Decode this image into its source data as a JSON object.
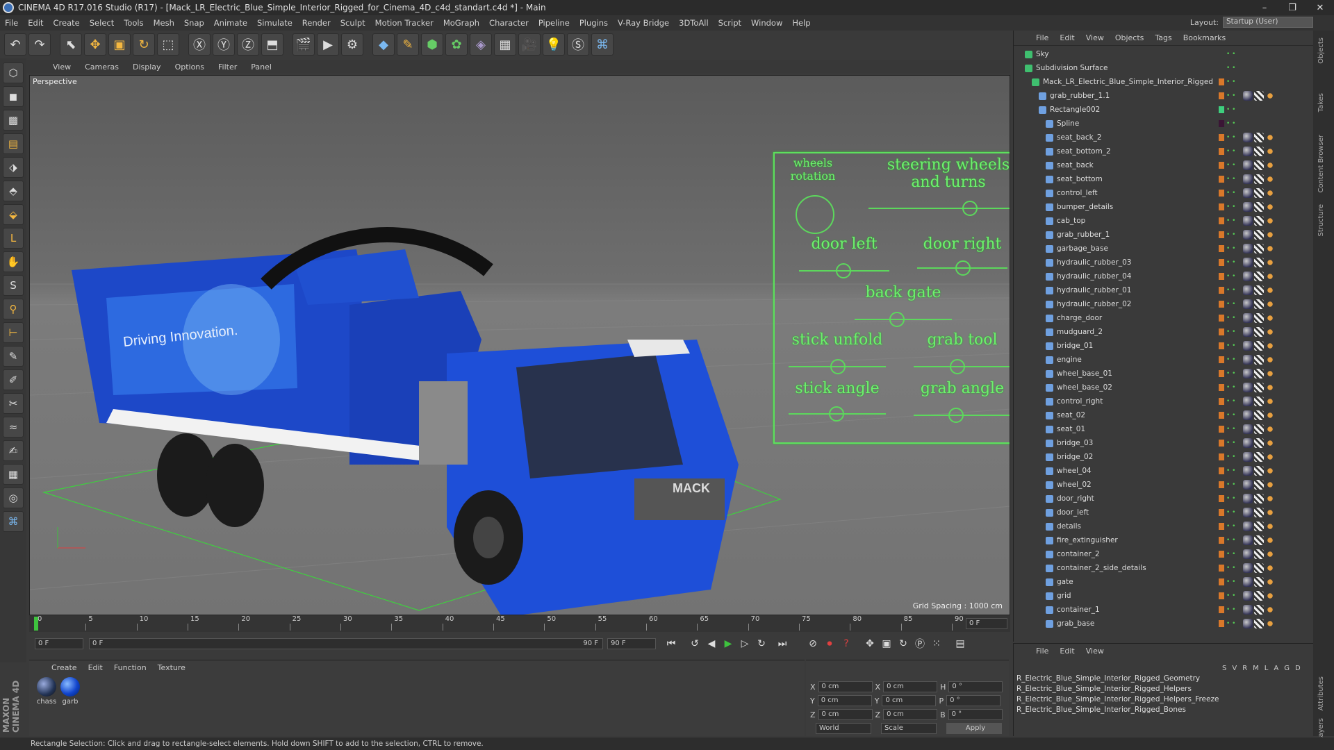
{
  "window": {
    "title": "CINEMA 4D R17.016 Studio (R17) - [Mack_LR_Electric_Blue_Simple_Interior_Rigged_for_Cinema_4D_c4d_standart.c4d *] - Main"
  },
  "menu": [
    "File",
    "Edit",
    "Create",
    "Select",
    "Tools",
    "Mesh",
    "Snap",
    "Animate",
    "Simulate",
    "Render",
    "Sculpt",
    "Motion Tracker",
    "MoGraph",
    "Character",
    "Pipeline",
    "Plugins",
    "V-Ray Bridge",
    "3DToAll",
    "Script",
    "Window",
    "Help"
  ],
  "layout": {
    "label": "Layout:",
    "value": "Startup (User)"
  },
  "viewport": {
    "menu": [
      "View",
      "Cameras",
      "Display",
      "Options",
      "Filter",
      "Panel"
    ],
    "label": "Perspective",
    "grid_spacing": "Grid Spacing : 1000 cm",
    "truck_text": "Driving Innovation.",
    "hud": {
      "wheels_rotation": "wheels rotation",
      "steering": "steering wheels and turns",
      "door_left": "door left",
      "door_right": "door right",
      "back_gate": "back gate",
      "stick_unfold": "stick unfold",
      "grab_tool": "grab tool",
      "stick_angle": "stick angle",
      "grab_angle": "grab angle"
    }
  },
  "timeline": {
    "ticks": [
      "0",
      "5",
      "10",
      "15",
      "20",
      "25",
      "30",
      "35",
      "40",
      "45",
      "50",
      "55",
      "60",
      "65",
      "70",
      "75",
      "80",
      "85",
      "90"
    ],
    "end_frame": "0 F"
  },
  "playback": {
    "start": "0 F",
    "current": "0 F",
    "range_end": "90 F",
    "max": "90 F"
  },
  "materials": {
    "menu": [
      "Create",
      "Edit",
      "Function",
      "Texture"
    ],
    "items": [
      "chass",
      "garb"
    ]
  },
  "coords": {
    "rows": [
      {
        "axis": "X",
        "pos": "0 cm",
        "axis2": "X",
        "size": "0 cm",
        "axis3": "H",
        "rot": "0 °"
      },
      {
        "axis": "Y",
        "pos": "0 cm",
        "axis2": "Y",
        "size": "0 cm",
        "axis3": "P",
        "rot": "0 °"
      },
      {
        "axis": "Z",
        "pos": "0 cm",
        "axis2": "Z",
        "size": "0 cm",
        "axis3": "B",
        "rot": "0 °"
      }
    ],
    "world": "World",
    "scale": "Scale",
    "apply": "Apply"
  },
  "objects": {
    "menu": [
      "File",
      "Edit",
      "View",
      "Objects",
      "Tags",
      "Bookmarks"
    ],
    "items": [
      {
        "name": "Sky",
        "level": 0
      },
      {
        "name": "Subdivision Surface",
        "level": 0
      },
      {
        "name": "Mack_LR_Electric_Blue_Simple_Interior_Rigged",
        "level": 1
      },
      {
        "name": "grab_rubber_1.1",
        "level": 2
      },
      {
        "name": "Rectangle002",
        "level": 2
      },
      {
        "name": "Spline",
        "level": 3
      },
      {
        "name": "seat_back_2",
        "level": 3
      },
      {
        "name": "seat_bottom_2",
        "level": 3
      },
      {
        "name": "seat_back",
        "level": 3
      },
      {
        "name": "seat_bottom",
        "level": 3
      },
      {
        "name": "control_left",
        "level": 3
      },
      {
        "name": "bumper_details",
        "level": 3
      },
      {
        "name": "cab_top",
        "level": 3
      },
      {
        "name": "grab_rubber_1",
        "level": 3
      },
      {
        "name": "garbage_base",
        "level": 3
      },
      {
        "name": "hydraulic_rubber_03",
        "level": 3
      },
      {
        "name": "hydraulic_rubber_04",
        "level": 3
      },
      {
        "name": "hydraulic_rubber_01",
        "level": 3
      },
      {
        "name": "hydraulic_rubber_02",
        "level": 3
      },
      {
        "name": "charge_door",
        "level": 3
      },
      {
        "name": "mudguard_2",
        "level": 3
      },
      {
        "name": "bridge_01",
        "level": 3
      },
      {
        "name": "engine",
        "level": 3
      },
      {
        "name": "wheel_base_01",
        "level": 3
      },
      {
        "name": "wheel_base_02",
        "level": 3
      },
      {
        "name": "control_right",
        "level": 3
      },
      {
        "name": "seat_02",
        "level": 3
      },
      {
        "name": "seat_01",
        "level": 3
      },
      {
        "name": "bridge_03",
        "level": 3
      },
      {
        "name": "bridge_02",
        "level": 3
      },
      {
        "name": "wheel_04",
        "level": 3
      },
      {
        "name": "wheel_02",
        "level": 3
      },
      {
        "name": "door_right",
        "level": 3
      },
      {
        "name": "door_left",
        "level": 3
      },
      {
        "name": "details",
        "level": 3
      },
      {
        "name": "fire_extinguisher",
        "level": 3
      },
      {
        "name": "container_2",
        "level": 3
      },
      {
        "name": "container_2_side_details",
        "level": 3
      },
      {
        "name": "gate",
        "level": 3
      },
      {
        "name": "grid",
        "level": 3
      },
      {
        "name": "container_1",
        "level": 3
      },
      {
        "name": "grab_base",
        "level": 3
      }
    ]
  },
  "layers": {
    "menu": [
      "File",
      "Edit",
      "View"
    ],
    "columns": [
      "S",
      "V",
      "R",
      "M",
      "L",
      "A",
      "G",
      "D"
    ],
    "items": [
      "R_Electric_Blue_Simple_Interior_Rigged_Geometry",
      "R_Electric_Blue_Simple_Interior_Rigged_Helpers",
      "R_Electric_Blue_Simple_Interior_Rigged_Helpers_Freeze",
      "R_Electric_Blue_Simple_Interior_Rigged_Bones"
    ]
  },
  "status": "Rectangle Selection: Click and drag to rectangle-select elements. Hold down SHIFT to add to the selection, CTRL to remove.",
  "side_tabs": [
    "Objects",
    "Takes",
    "Content Browser",
    "Structure",
    "Attributes",
    "Layers"
  ],
  "brand": "MAXON CINEMA 4D"
}
